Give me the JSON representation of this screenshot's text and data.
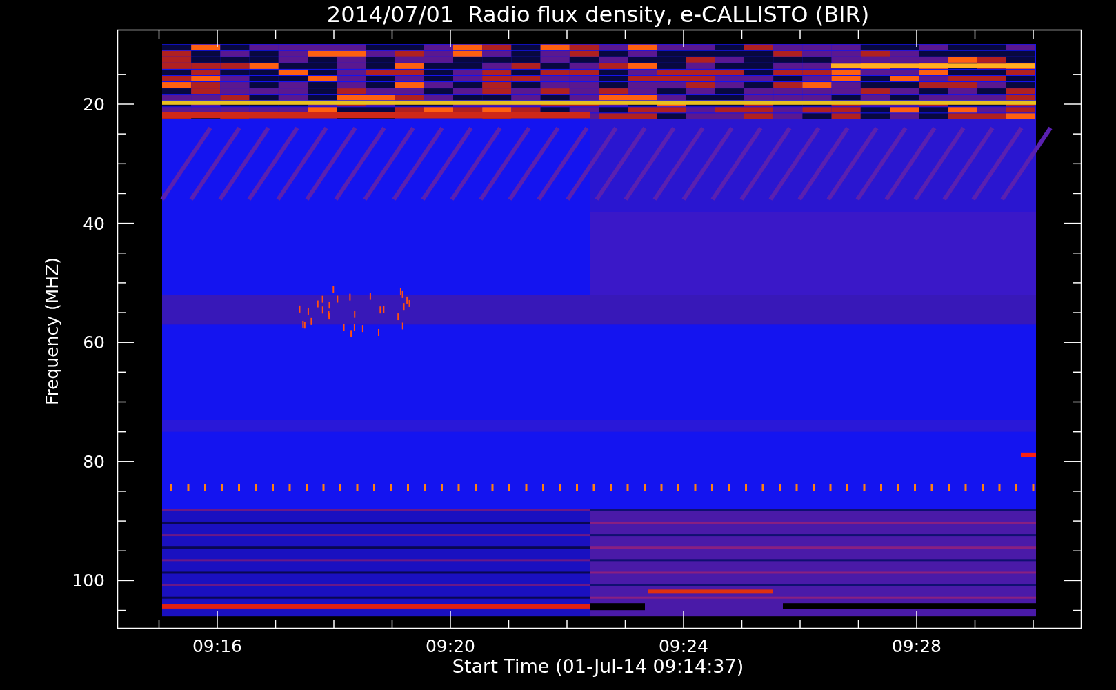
{
  "title": "2014/07/01  Radio flux density, e-CALLISTO (BIR)",
  "y_axis": {
    "label": "Frequency (MHZ)",
    "ticks": [
      "20",
      "40",
      "60",
      "80",
      "100"
    ]
  },
  "x_axis": {
    "label": "Start Time (01-Jul-14 09:14:37)",
    "ticks": [
      "09:16",
      "09:20",
      "09:24",
      "09:28"
    ]
  }
}
